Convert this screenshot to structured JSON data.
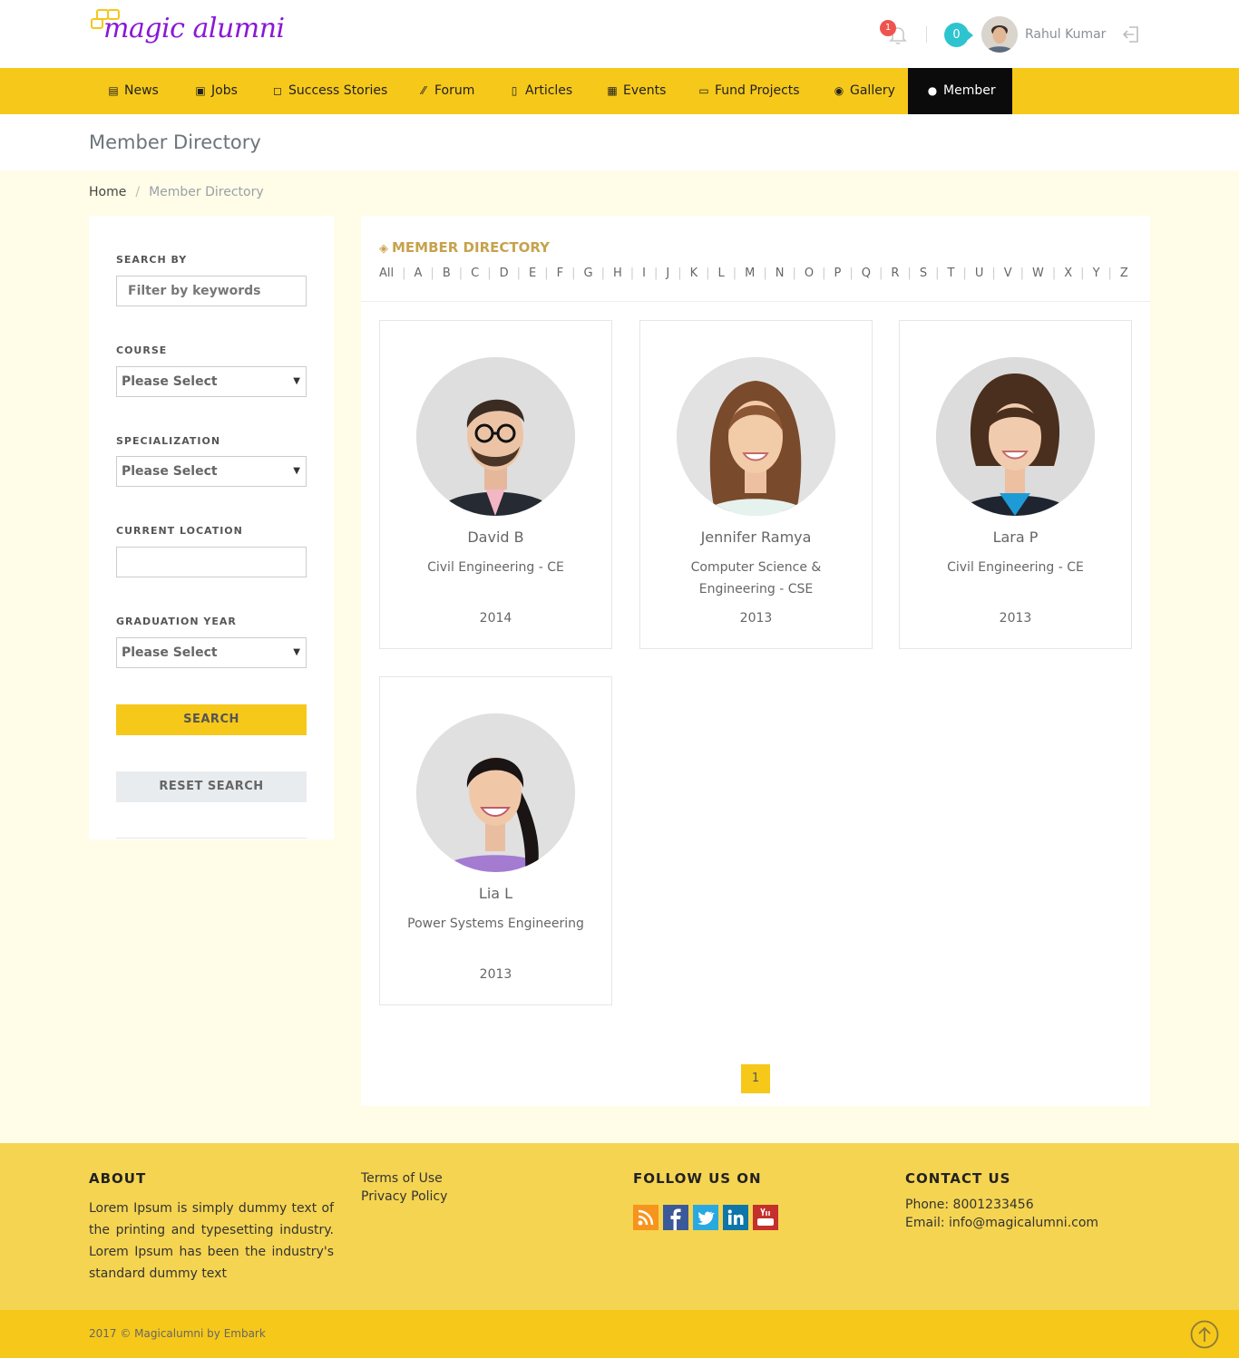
{
  "brand": {
    "logo_text": "magic alumni"
  },
  "header": {
    "notification_count": "1",
    "message_count": "0",
    "user_name": "Rahul Kumar"
  },
  "nav": [
    {
      "label": "News",
      "icon": "newspaper-icon"
    },
    {
      "label": "Jobs",
      "icon": "briefcase-icon"
    },
    {
      "label": "Success Stories",
      "icon": "note-icon"
    },
    {
      "label": "Forum",
      "icon": "forum-icon"
    },
    {
      "label": "Articles",
      "icon": "article-icon"
    },
    {
      "label": "Events",
      "icon": "calendar-icon"
    },
    {
      "label": "Fund Projects",
      "icon": "money-icon"
    },
    {
      "label": "Gallery",
      "icon": "play-circle-icon"
    },
    {
      "label": "Member",
      "icon": "user-icon",
      "active": true
    }
  ],
  "page": {
    "title": "Member Directory"
  },
  "breadcrumb": {
    "home": "Home",
    "separator": "/",
    "current": "Member Directory"
  },
  "filters": {
    "search_label": "SEARCH BY",
    "search_placeholder": "Filter by keywords",
    "course_label": "COURSE",
    "course_value": "Please Select",
    "specialization_label": "SPECIALIZATION",
    "specialization_value": "Please Select",
    "location_label": "CURRENT LOCATION",
    "location_value": "",
    "year_label": "GRADUATION YEAR",
    "year_value": "Please Select",
    "search_button": "SEARCH",
    "reset_button": "RESET SEARCH"
  },
  "directory": {
    "heading": "MEMBER DIRECTORY",
    "letters": [
      "All",
      "A",
      "B",
      "C",
      "D",
      "E",
      "F",
      "G",
      "H",
      "I",
      "J",
      "K",
      "L",
      "M",
      "N",
      "O",
      "P",
      "Q",
      "R",
      "S",
      "T",
      "U",
      "V",
      "W",
      "X",
      "Y",
      "Z"
    ],
    "members": [
      {
        "name": "David B",
        "department": "Civil Engineering - CE",
        "year": "2014"
      },
      {
        "name": "Jennifer Ramya",
        "department": "Computer Science & Engineering - CSE",
        "year": "2013"
      },
      {
        "name": "Lara P",
        "department": "Civil Engineering - CE",
        "year": "2013"
      },
      {
        "name": "Lia L",
        "department": "Power Systems Engineering",
        "year": "2013"
      }
    ],
    "current_page": "1"
  },
  "footer": {
    "about_heading": "ABOUT",
    "about_text": "Lorem Ipsum is simply dummy text of the printing and typesetting industry. Lorem Ipsum has been the industry's standard dummy text",
    "links": [
      "Terms of Use",
      "Privacy Policy"
    ],
    "follow_heading": "FOLLOW US ON",
    "social": [
      {
        "icon": "rss-icon",
        "color": "#f7941d"
      },
      {
        "icon": "facebook-icon",
        "color": "#3b5998"
      },
      {
        "icon": "twitter-icon",
        "color": "#2aa9e0"
      },
      {
        "icon": "linkedin-icon",
        "color": "#0e76a8"
      },
      {
        "icon": "youtube-icon",
        "color": "#c4302b"
      }
    ],
    "contact_heading": "CONTACT US",
    "phone": "Phone: 8001233456",
    "email": "Email: info@magicalumni.com",
    "copyright": "2017 © Magicalumni by Embark"
  },
  "colors": {
    "accent": "#f6c81a",
    "footer": "#f5d451",
    "logo": "#8a17d6",
    "heading": "#c7a24d"
  }
}
